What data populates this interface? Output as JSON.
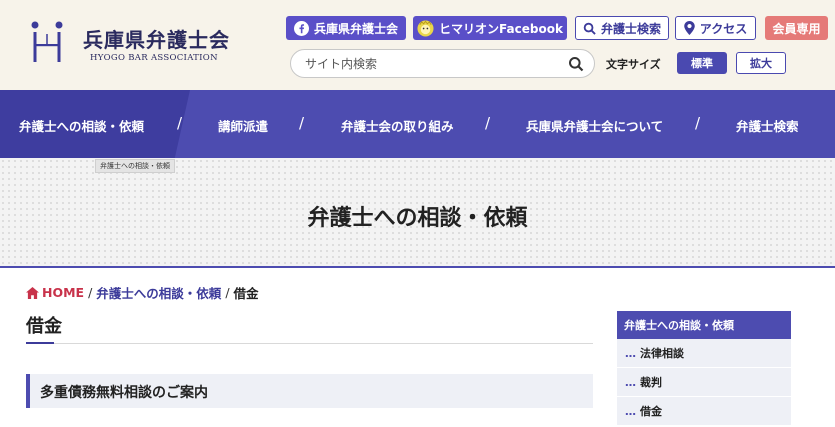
{
  "header": {
    "logo_jp": "兵庫県弁護士会",
    "logo_en": "HYOGO BAR ASSOCIATION",
    "buttons": [
      {
        "label": "兵庫県弁護士会",
        "icon": "facebook-icon"
      },
      {
        "label": "ヒマリオンFacebook",
        "icon": "himarion-mascot-icon"
      },
      {
        "label": "弁護士検索",
        "icon": "search-icon"
      },
      {
        "label": "アクセス",
        "icon": "map-pin-icon"
      },
      {
        "label": "会員専用"
      }
    ],
    "search_placeholder": "サイト内検索",
    "font_size_label": "文字サイズ",
    "font_size_standard": "標準",
    "font_size_large": "拡大"
  },
  "nav": {
    "items": [
      "弁護士への相談・依頼",
      "講師派遣",
      "弁護士会の取り組み",
      "兵庫県弁護士会について",
      "弁護士検索"
    ],
    "separator": "/",
    "tooltip": "弁護士への相談・依頼"
  },
  "hero": {
    "title": "弁護士への相談・依頼"
  },
  "breadcrumb": {
    "home": "HOME",
    "parent": "弁護士への相談・依頼",
    "current": "借金",
    "separator": "/"
  },
  "main": {
    "page_title": "借金",
    "section_title": "多重債務無料相談のご案内"
  },
  "sidebar": {
    "heading": "弁護士への相談・依頼",
    "items": [
      "法律相談",
      "裁判",
      "借金"
    ],
    "bullet": "…"
  },
  "colors": {
    "primary": "#4d4cb0",
    "header_bg": "#f7f3ea",
    "member_button": "#e57a78",
    "home_link": "#c8324a"
  }
}
